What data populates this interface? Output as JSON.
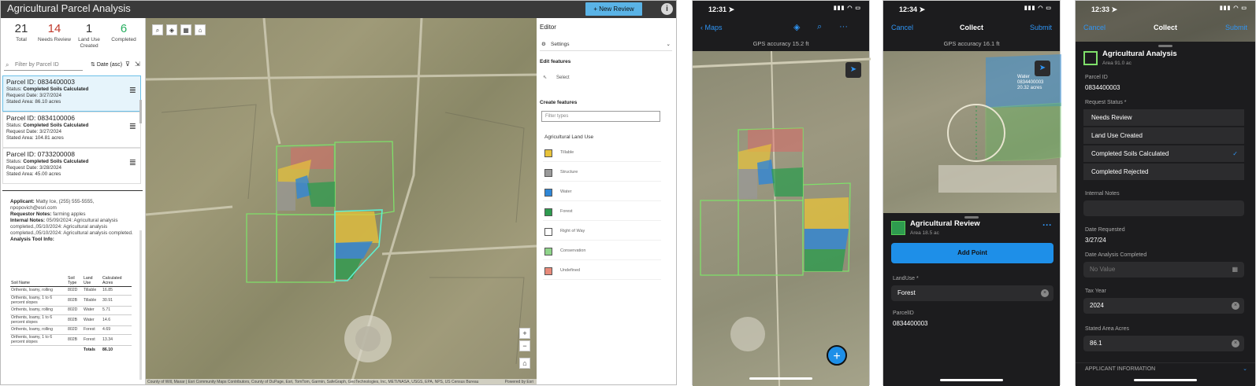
{
  "web": {
    "title": "Agricultural Parcel Analysis",
    "new_review_label": "+ New Review",
    "info_icon": "i",
    "stats": [
      {
        "count": "21",
        "label": "Total",
        "color": "#333333"
      },
      {
        "count": "14",
        "label": "Needs Review",
        "color": "#c0392b"
      },
      {
        "count": "1",
        "label": "Land Use Created",
        "color": "#333333"
      },
      {
        "count": "6",
        "label": "Completed",
        "color": "#27ae60"
      }
    ],
    "filter_placeholder": "Filter by Parcel ID",
    "sort_label": "Date (asc)",
    "parcels": [
      {
        "id": "Parcel ID: 0834400003",
        "status_label": "Status:",
        "status": "Completed Soils Calculated",
        "date": "Request Date: 3/27/2024",
        "area": "Stated Area: 86.10 acres"
      },
      {
        "id": "Parcel ID: 0834100006",
        "status_label": "Status:",
        "status": "Completed Soils Calculated",
        "date": "Request Date: 3/27/2024",
        "area": "Stated Area: 104.81 acres"
      },
      {
        "id": "Parcel ID: 0733200008",
        "status_label": "Status:",
        "status": "Completed Soils Calculated",
        "date": "Request Date: 3/28/2024",
        "area": "Stated Area: 45.00 acres"
      }
    ],
    "details": {
      "applicant_label": "Applicant:",
      "applicant": "Matty Ice, (255) 555-5555, npopovich@esri.com",
      "notes_label": "Requestor Notes:",
      "notes": "farming apples",
      "internal_label": "Internal Notes:",
      "internal": "05/09/2024: Agricultural analysis completed.,05/10/2024: Agricultural analysis completed.,05/10/2024: Agricultural analysis completed.",
      "tool_label": "Analysis Tool Info:"
    },
    "soil_table": {
      "headers": [
        "Soil Name",
        "Soil Type",
        "Land Use",
        "Calculated Acres"
      ],
      "rows": [
        [
          "Orthents, loamy, rolling",
          "802D",
          "Tillable",
          "16.85"
        ],
        [
          "Orthents, loamy, 1 to 6 percent slopes",
          "802B",
          "Tillable",
          "30.91"
        ],
        [
          "Orthents, loamy, rolling",
          "802D",
          "Water",
          "5.71"
        ],
        [
          "Orthents, loamy, 1 to 6 percent slopes",
          "802B",
          "Water",
          "14.6"
        ],
        [
          "Orthents, loamy, rolling",
          "802D",
          "Forest",
          "4.69"
        ],
        [
          "Orthents, loamy, 1 to 6 percent slopes",
          "802B",
          "Forest",
          "13.34"
        ]
      ],
      "total_label": "Totals",
      "total": "86.10"
    },
    "attribution": "County of Will, Maxar | Esri Community Maps Contributors, County of DuPage, Esri, TomTom, Garmin, SafeGraph, GeoTechnologies, Inc, METI/NASA, USGS, EPA, NPS, US Census Bureau",
    "powered_by": "Powered by Esri",
    "editor": {
      "title": "Editor",
      "settings": "Settings",
      "edit_features": "Edit features",
      "select": "Select",
      "create_features": "Create features",
      "filter_placeholder": "Filter types",
      "group": "Agricultural Land Use",
      "types": [
        {
          "label": "Tillable",
          "color": "#e8c33a"
        },
        {
          "label": "Structure",
          "color": "#9a9a9a"
        },
        {
          "label": "Water",
          "color": "#2f86d6"
        },
        {
          "label": "Forest",
          "color": "#2e9b4f"
        },
        {
          "label": "Right of Way",
          "color": "#ffffff"
        },
        {
          "label": "Conservation",
          "color": "#8fd48a"
        },
        {
          "label": "Undefined",
          "color": "#e88a7a"
        }
      ]
    }
  },
  "phone1": {
    "time": "12:31",
    "back": "Maps",
    "gps": "GPS accuracy 15.2 ft",
    "fab": "+"
  },
  "phone2": {
    "time": "12:34",
    "cancel": "Cancel",
    "title": "Collect",
    "submit": "Submit",
    "gps": "GPS accuracy 16.1 ft",
    "map_label_1": "Water",
    "map_label_2": "0834400003",
    "map_label_3": "20.32 acres",
    "feature_title": "Agricultural Review",
    "feature_area": "Area 18.5 ac",
    "add_point": "Add Point",
    "landuse_label": "LandUse *",
    "landuse_value": "Forest",
    "parcel_label": "ParcelID",
    "parcel_value": "0834400003",
    "more": "···"
  },
  "phone3": {
    "time": "12:33",
    "cancel": "Cancel",
    "title": "Collect",
    "submit": "Submit",
    "feature_title": "Agricultural Analysis",
    "feature_area": "Area 91.0 ac",
    "parcel_label": "Parcel ID",
    "parcel_value": "0834400003",
    "status_label": "Request Status *",
    "options": [
      "Needs Review",
      "Land Use Created",
      "Completed Soils Calculated",
      "Completed Rejected"
    ],
    "checkmark": "✓",
    "internal_label": "Internal Notes",
    "date_req_label": "Date Requested",
    "date_req_value": "3/27/24",
    "date_done_label": "Date Analysis Completed",
    "date_done_placeholder": "No Value",
    "tax_label": "Tax Year",
    "tax_value": "2024",
    "area_label": "Stated Area Acres",
    "area_value": "86.1",
    "section": "APPLICANT INFORMATION"
  }
}
